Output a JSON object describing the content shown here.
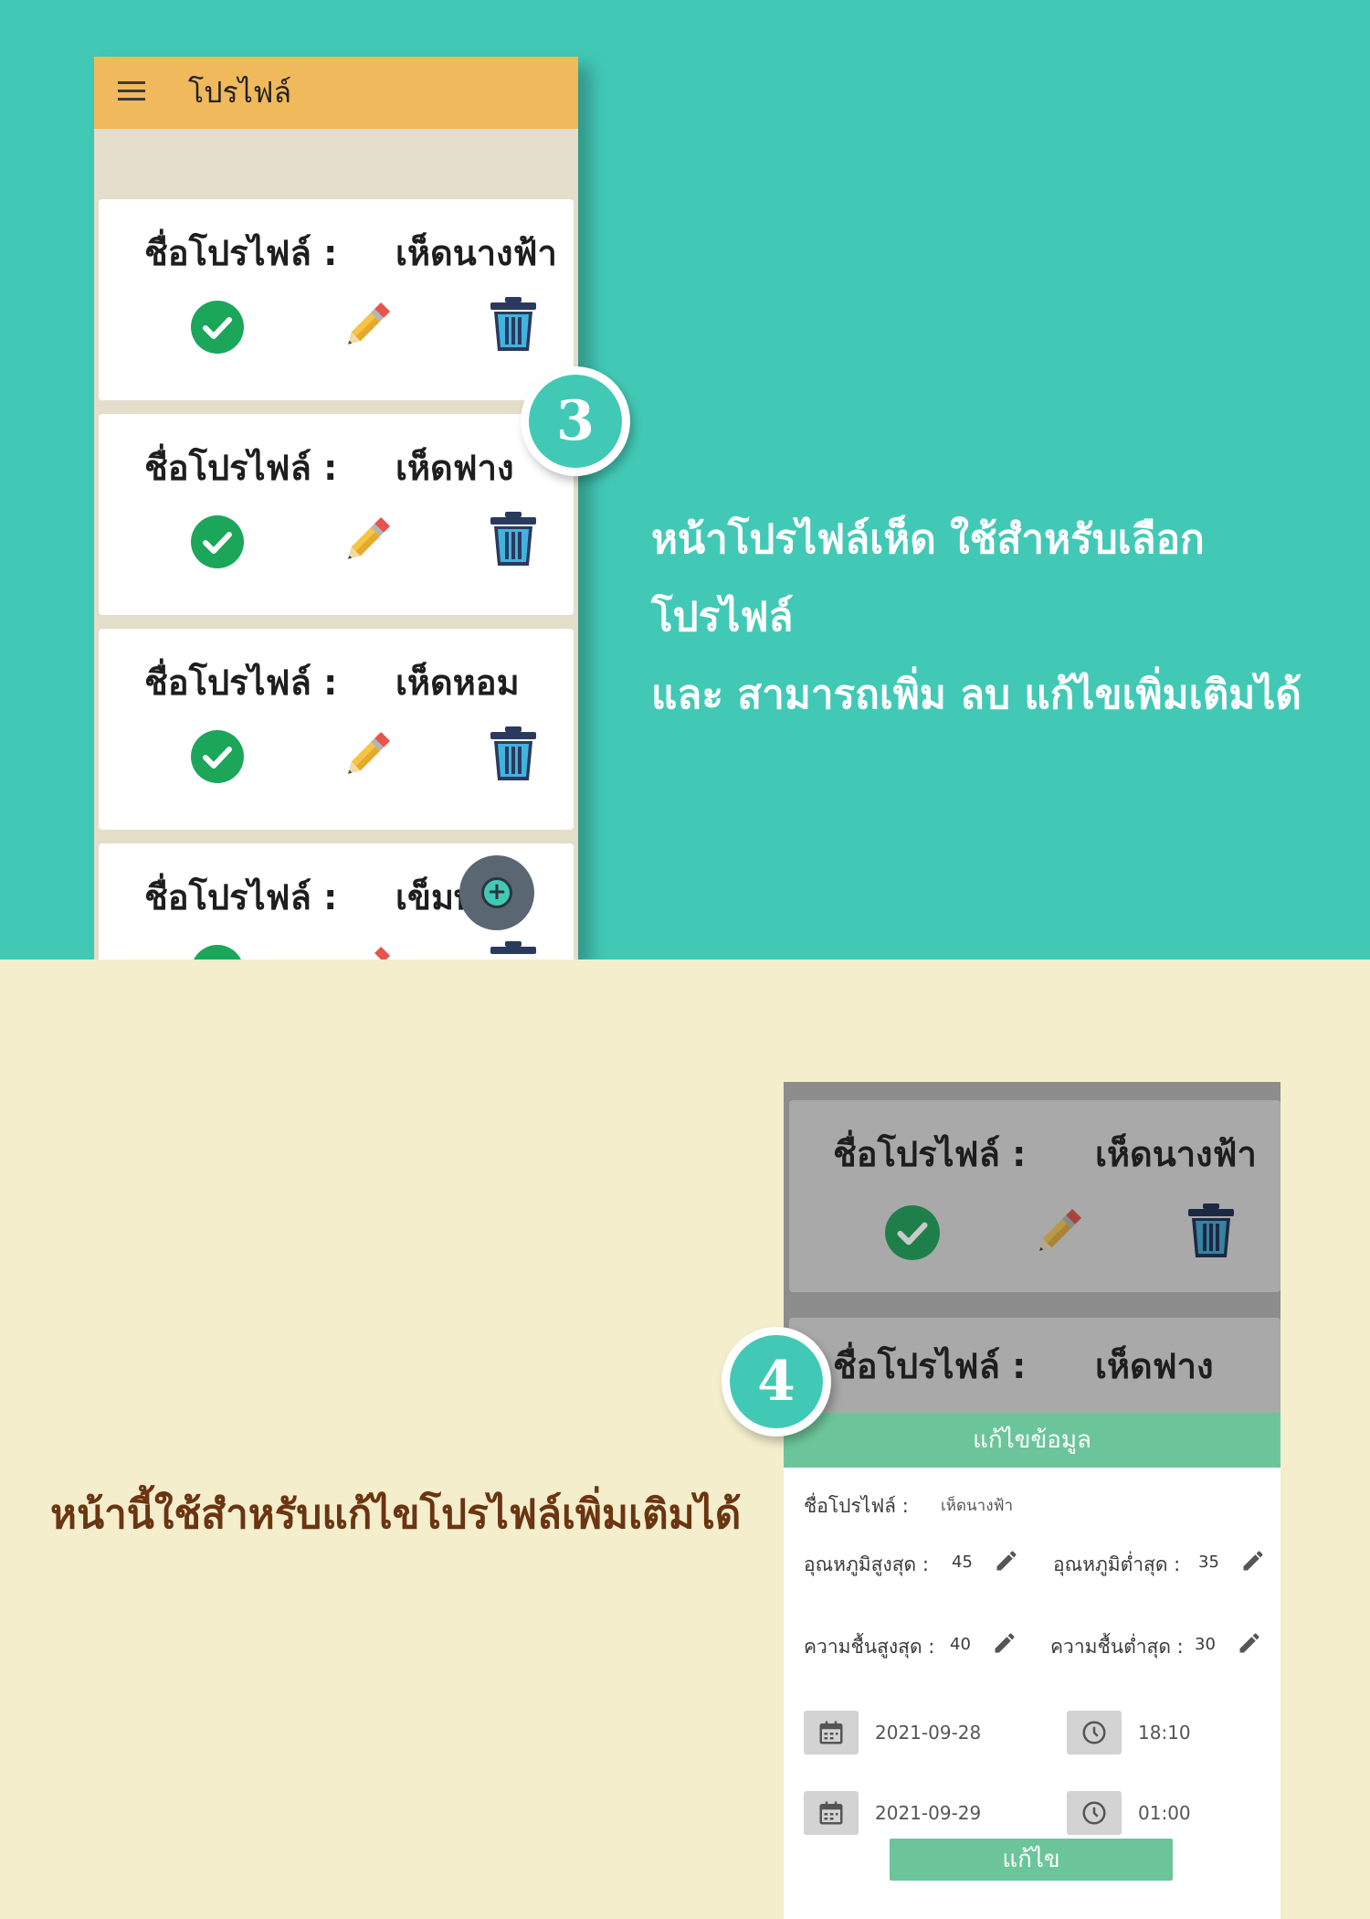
{
  "app": {
    "title": "โปรไฟล์"
  },
  "profiles": [
    {
      "label": "ชื่อโปรไฟล์ :",
      "name": "เห็ดนางฟ้า"
    },
    {
      "label": "ชื่อโปรไฟล์ :",
      "name": "เห็ดฟาง"
    },
    {
      "label": "ชื่อโปรไฟล์ :",
      "name": "เห็ดหอม"
    },
    {
      "label": "ชื่อโปรไฟล์ :",
      "name": "เข็มท"
    }
  ],
  "steps": {
    "step3": "3",
    "step4": "4"
  },
  "descriptions": {
    "top_line1": "หน้าโปรไฟล์เห็ด ใช้สำหรับเลือกโปรไฟล์",
    "top_line2": "และ สามารถเพิ่ม ลบ แก้ไขเพิ่มเติมได้",
    "bottom": "หน้านี้ใช้สำหรับแก้ไขโปรไฟล์เพิ่มเติมได้"
  },
  "edit_dialog": {
    "title": "แก้ไขข้อมูล",
    "profile_label": "ชื่อโปรไฟล์ :",
    "profile_value": "เห็ดนางฟ้า",
    "temp_max_label": "อุณหภูมิสูงสุด :",
    "temp_max_value": "45",
    "temp_min_label": "อุณหภูมิต่ำสุด :",
    "temp_min_value": "35",
    "hum_max_label": "ความชื้นสูงสุด :",
    "hum_max_value": "40",
    "hum_min_label": "ความชื้นต่ำสุด :",
    "hum_min_value": "30",
    "start_date": "2021-09-28",
    "start_time": "18:10",
    "end_date": "2021-09-29",
    "end_time": "01:00",
    "submit_label": "แก้ไข"
  },
  "icons": {
    "menu": "menu-icon",
    "check": "check-circle-icon",
    "edit": "pencil-icon",
    "delete": "trash-icon",
    "add": "plus-circle-icon",
    "calendar": "calendar-icon",
    "clock": "clock-icon"
  },
  "colors": {
    "teal_background": "#42c9b6",
    "cream_background": "#f4eecd",
    "appbar": "#f0b95b",
    "dialog_accent": "#6cc59a",
    "check_green": "#1ba65a",
    "text_brown": "#6b3511"
  }
}
